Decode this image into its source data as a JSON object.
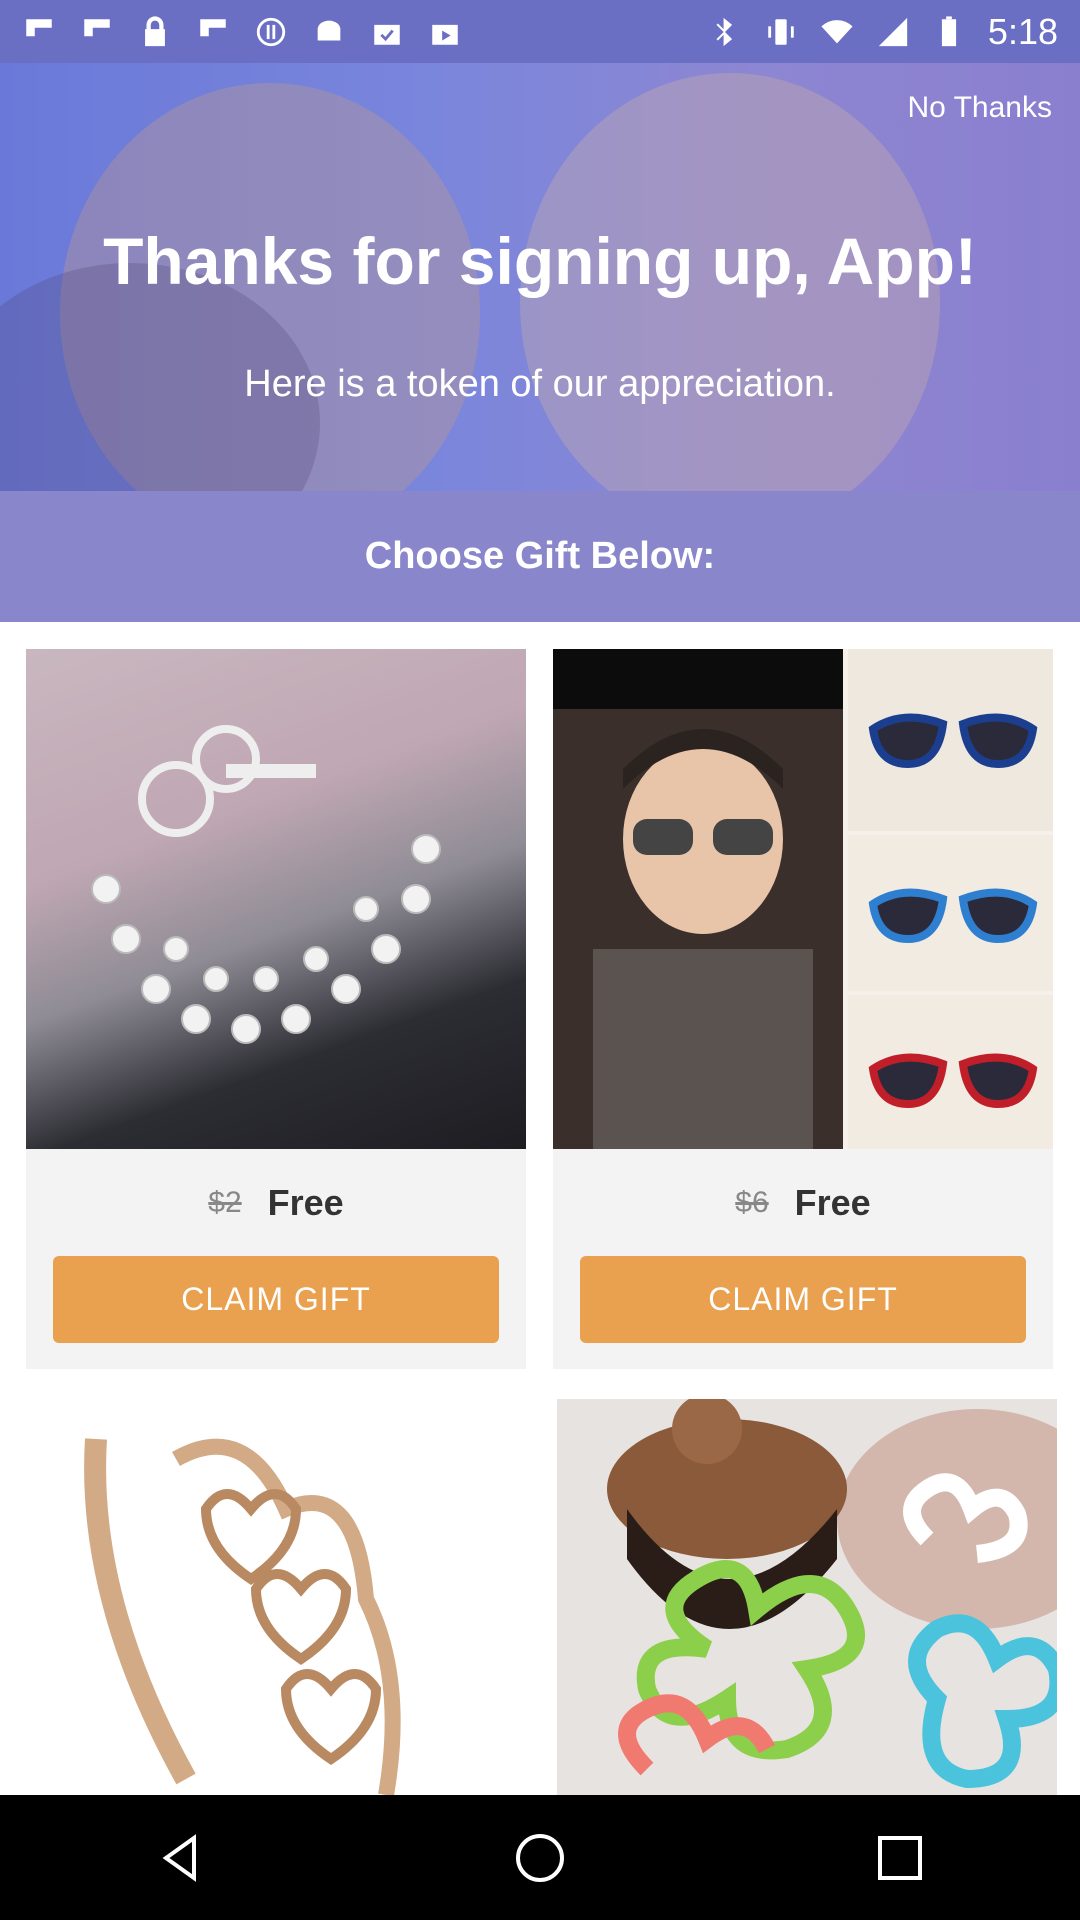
{
  "status_bar": {
    "time": "5:18",
    "left_icons": [
      "flipboard-icon",
      "flipboard-icon",
      "lock-icon",
      "flipboard-icon",
      "circle-icon",
      "android-icon",
      "shopping-check-icon",
      "shopping-play-icon"
    ],
    "right_icons": [
      "bluetooth-icon",
      "vibrate-icon",
      "wifi-icon",
      "signal-icon",
      "battery-icon"
    ]
  },
  "hero": {
    "dismiss_label": "No Thanks",
    "title": "Thanks for signing up, App!",
    "subtitle": "Here is a token of our appreciation."
  },
  "choose_label": "Choose Gift Below:",
  "gifts": [
    {
      "image": "silver-bead-bracelet",
      "old_price": "$2",
      "price": "Free",
      "button": "CLAIM GIFT"
    },
    {
      "image": "kids-aviator-sunglasses",
      "old_price": "$6",
      "price": "Free",
      "button": "CLAIM GIFT"
    },
    {
      "image": "heart-crystal-bangle"
    },
    {
      "image": "flower-trivets"
    }
  ],
  "colors": {
    "accent": "#e9a14f",
    "header": "#8a86cc",
    "status": "#6b6fc4"
  },
  "nav": [
    "back-icon",
    "home-icon",
    "recents-icon"
  ]
}
